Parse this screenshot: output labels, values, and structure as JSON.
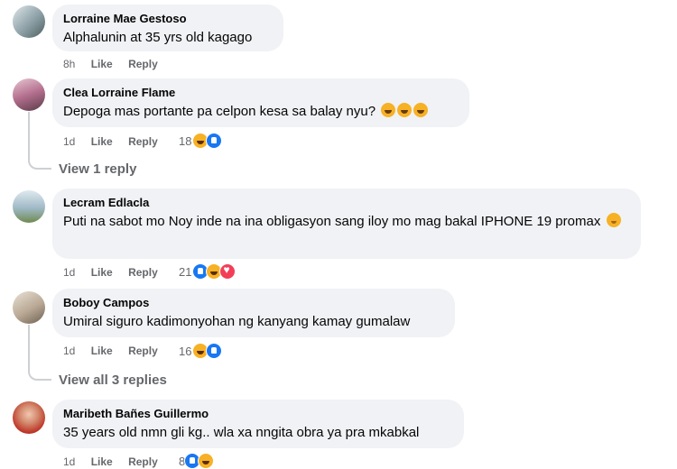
{
  "comments": [
    {
      "author": "Lorraine Mae Gestoso",
      "text": "Alphalunin at 35 yrs old kagago",
      "time": "8h",
      "like": "Like",
      "reply": "Reply",
      "avatar_color": "#8ca0a6"
    },
    {
      "author": "Clea Lorraine Flame",
      "text": "Depoga mas portante pa celpon kesa sa balay nyu?",
      "emojis": [
        "haha-emoji",
        "haha-emoji",
        "haha-emoji"
      ],
      "time": "1d",
      "like": "Like",
      "reply": "Reply",
      "reaction_count": "18",
      "reactions": [
        "haha",
        "like"
      ],
      "view_replies": "View 1 reply",
      "avatar_color": "#b36f8e"
    },
    {
      "author": "Lecram Edlacla",
      "text": "Puti na sabot mo Noy inde na ina obligasyon sang iloy mo mag bakal IPHONE 19 promax",
      "emojis": [
        "smile-emoji"
      ],
      "time": "1d",
      "like": "Like",
      "reply": "Reply",
      "reaction_count": "21",
      "reactions": [
        "like",
        "haha",
        "heart"
      ],
      "avatar_color": "#9fb9c6"
    },
    {
      "author": "Boboy Campos",
      "text": "Umiral siguro kadimonyohan ng kanyang kamay gumalaw",
      "time": "1d",
      "like": "Like",
      "reply": "Reply",
      "reaction_count": "16",
      "reactions": [
        "haha",
        "like"
      ],
      "view_replies": "View all 3 replies",
      "avatar_color": "#b9a894"
    },
    {
      "author": "Maribeth Bañes Guillermo",
      "text": "35 years old nmn gli kg.. wla xa nngita obra ya pra mkabkal",
      "time": "1d",
      "like": "Like",
      "reply": "Reply",
      "reaction_count": "8",
      "reactions": [
        "like",
        "haha"
      ],
      "avatar_color": "#c0392b"
    }
  ]
}
